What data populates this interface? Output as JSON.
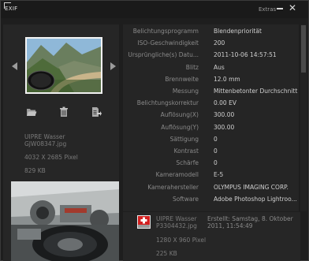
{
  "titlebar": {
    "title": "EXIF",
    "extras": "Extras",
    "minimize_symbol": "—",
    "close_symbol": "✕"
  },
  "current_file": {
    "name": "UIPRE Wasser",
    "file": "GJW08347.jpg",
    "dimensions": "4032 X 2685 Pixel",
    "size": "829 KB"
  },
  "properties": [
    {
      "label": "Belichtungsprogramm",
      "value": "Blendenpriorität"
    },
    {
      "label": "ISO-Geschwindigkeit",
      "value": "200"
    },
    {
      "label": "Ursprüngliche(s) Datu...",
      "value": "2011-10-06 14:57:51"
    },
    {
      "label": "Blitz",
      "value": "Aus"
    },
    {
      "label": "Brennweite",
      "value": "12.0 mm"
    },
    {
      "label": "Messung",
      "value": "Mittenbetonter Durchschnitt"
    },
    {
      "label": "Belichtungskorrektur",
      "value": "0.00 EV"
    },
    {
      "label": "Auflösung(X)",
      "value": "300.00"
    },
    {
      "label": "Auflösung(Y)",
      "value": "300.00"
    },
    {
      "label": "Sättigung",
      "value": "0"
    },
    {
      "label": "Kontrast",
      "value": "0"
    },
    {
      "label": "Schärfe",
      "value": "0"
    },
    {
      "label": "Kameramodell",
      "value": "E-5"
    },
    {
      "label": "Kamerahersteller",
      "value": "OLYMPUS IMAGING CORP."
    },
    {
      "label": "Software",
      "value": "Adobe Photoshop Lightroo..."
    }
  ],
  "next_file": {
    "name": "UIPRE Wasser",
    "file": "P3304432.jpg",
    "created": "Erstellt: Samstag, 8. Oktober 2011, 11:54:49",
    "dimensions": "1280 X 960 Pixel",
    "size": "225 KB"
  },
  "icons": [
    "prev-arrow",
    "next-arrow",
    "folder-icon",
    "delete-icon",
    "export-icon"
  ]
}
